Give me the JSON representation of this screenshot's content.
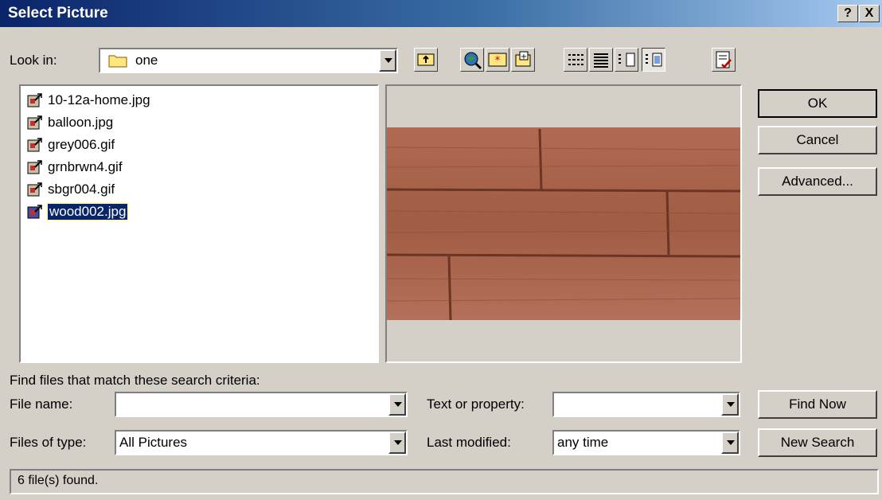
{
  "window": {
    "title": "Select Picture",
    "help_glyph": "?",
    "close_glyph": "X"
  },
  "look_in": {
    "label": "Look in:",
    "value": "one"
  },
  "files": [
    {
      "name": "10-12a-home.jpg",
      "selected": false
    },
    {
      "name": "balloon.jpg",
      "selected": false
    },
    {
      "name": "grey006.gif",
      "selected": false
    },
    {
      "name": "grnbrwn4.gif",
      "selected": false
    },
    {
      "name": "sbgr004.gif",
      "selected": false
    },
    {
      "name": "wood002.jpg",
      "selected": true
    }
  ],
  "buttons": {
    "ok": "OK",
    "cancel": "Cancel",
    "advanced": "Advanced...",
    "find_now": "Find Now",
    "new_search": "New Search"
  },
  "search": {
    "criteria_label": "Find files that match these search criteria:",
    "file_name_label": "File name:",
    "file_name_value": "",
    "files_of_type_label": "Files of type:",
    "files_of_type_value": "All Pictures",
    "text_or_property_label": "Text or property:",
    "text_or_property_value": "",
    "last_modified_label": "Last modified:",
    "last_modified_value": "any time"
  },
  "status": {
    "text": "6 file(s) found."
  },
  "colors": {
    "title_gradient_start": "#0a246a",
    "selection": "#0a246a",
    "dialog_face": "#d4d0c8",
    "wood": "#a5604a"
  }
}
